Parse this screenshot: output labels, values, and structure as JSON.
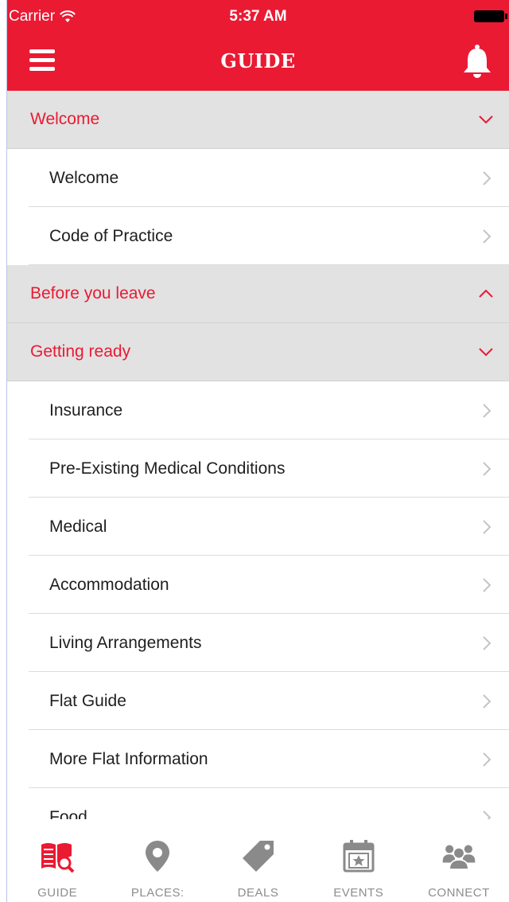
{
  "status_bar": {
    "carrier": "Carrier",
    "time": "5:37 AM"
  },
  "header": {
    "title": "GUIDE",
    "menu_icon": "hamburger-menu-icon",
    "bell_icon": "bell-icon"
  },
  "colors": {
    "brand_red": "#ea1a33",
    "section_bg": "#e2e2e2",
    "tab_grey": "#8d8d8d"
  },
  "list": {
    "rows": [
      {
        "kind": "section",
        "label": "Welcome",
        "expanded": false
      },
      {
        "kind": "item",
        "label": "Welcome"
      },
      {
        "kind": "item",
        "label": "Code of Practice"
      },
      {
        "kind": "section",
        "label": "Before you leave",
        "expanded": true
      },
      {
        "kind": "section",
        "label": "Getting ready",
        "expanded": false
      },
      {
        "kind": "item",
        "label": "Insurance"
      },
      {
        "kind": "item",
        "label": "Pre-Existing Medical Conditions"
      },
      {
        "kind": "item",
        "label": "Medical"
      },
      {
        "kind": "item",
        "label": "Accommodation"
      },
      {
        "kind": "item",
        "label": "Living Arrangements"
      },
      {
        "kind": "item",
        "label": "Flat Guide"
      },
      {
        "kind": "item",
        "label": "More Flat Information"
      },
      {
        "kind": "item",
        "label": "Food"
      }
    ]
  },
  "tabs": [
    {
      "label": "GUIDE",
      "icon": "guide-book-icon",
      "active": true
    },
    {
      "label": "PLACES:",
      "icon": "map-pin-icon",
      "active": false
    },
    {
      "label": "DEALS",
      "icon": "tag-icon",
      "active": false
    },
    {
      "label": "EVENTS",
      "icon": "calendar-star-icon",
      "active": false
    },
    {
      "label": "CONNECT",
      "icon": "people-group-icon",
      "active": false
    }
  ]
}
